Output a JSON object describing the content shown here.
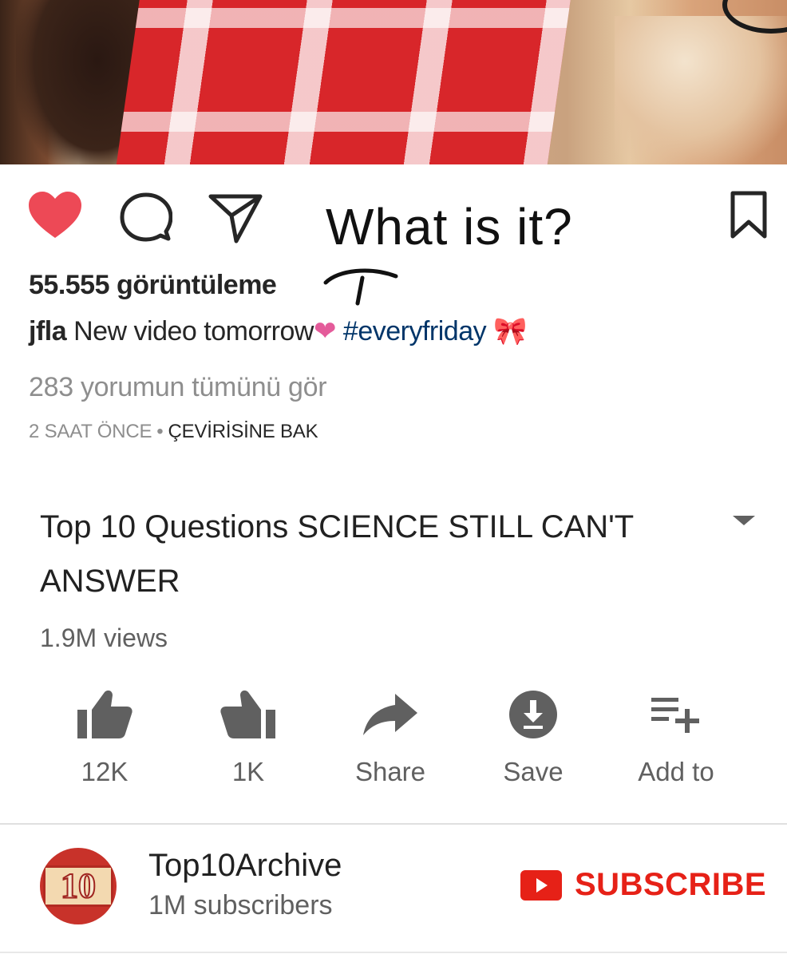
{
  "post": {
    "views_label": "55.555 görüntüleme",
    "caption_user": "jfla",
    "caption_text": " New video tomorrow",
    "caption_heart": "❤",
    "caption_hashtag": "#everyfriday",
    "caption_ribbon": "🎀",
    "comments_link": "283 yorumun tümünü gör",
    "time": "2 SAAT ÖNCE",
    "separator": "•",
    "translate_link": "ÇEVİRİSİNE BAK",
    "like_color": "#ed4956"
  },
  "annotation": {
    "text": "What is it?"
  },
  "video": {
    "title": "Top 10 Questions SCIENCE STILL CAN'T ANSWER",
    "views": "1.9M views",
    "actions": {
      "like": "12K",
      "dislike": "1K",
      "share": "Share",
      "save": "Save",
      "add_to": "Add to"
    }
  },
  "channel": {
    "logo_text": "10",
    "name": "Top10Archive",
    "subscribers": "1M subscribers",
    "subscribe_label": "SUBSCRIBE",
    "subscribe_color": "#e62117"
  }
}
